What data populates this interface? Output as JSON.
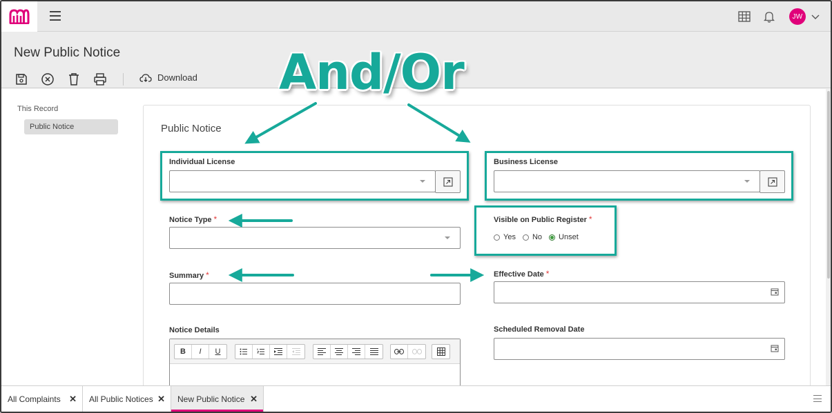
{
  "topbar": {
    "avatar_initials": "JW",
    "icons": [
      "app-logo-icon",
      "hamburger-menu-icon",
      "grid-icon",
      "bell-icon",
      "chevron-down-icon"
    ],
    "accent_color": "#e0007a"
  },
  "header": {
    "title": "New Public Notice",
    "download_label": "Download",
    "toolbar_icons": [
      "save-icon",
      "cancel-icon",
      "delete-icon",
      "print-icon",
      "cloud-download-icon"
    ]
  },
  "leftnav": {
    "section_label": "This Record",
    "items": [
      {
        "label": "Public Notice",
        "selected": true
      }
    ]
  },
  "form": {
    "title": "Public Notice",
    "individual_license": {
      "label": "Individual License",
      "value": ""
    },
    "business_license": {
      "label": "Business License",
      "value": ""
    },
    "notice_type": {
      "label": "Notice Type",
      "required_mark": "*",
      "value": ""
    },
    "visible_on_register": {
      "label": "Visible on Public Register",
      "required_mark": "*",
      "options": [
        "Yes",
        "No",
        "Unset"
      ],
      "selected": "Unset"
    },
    "summary": {
      "label": "Summary",
      "required_mark": "*",
      "value": ""
    },
    "effective_date": {
      "label": "Effective Date",
      "required_mark": "*",
      "value": ""
    },
    "notice_details": {
      "label": "Notice Details",
      "value": ""
    },
    "scheduled_removal_date": {
      "label": "Scheduled Removal Date",
      "value": ""
    },
    "editor_buttons": {
      "bold": "B",
      "italic": "I",
      "underline": "U"
    }
  },
  "annotation": {
    "text": "And/Or",
    "color": "#17a99a"
  },
  "tabs": [
    {
      "label": "All Complaints",
      "close": "✕",
      "active": false
    },
    {
      "label": "All Public Notices",
      "close": "✕",
      "active": false
    },
    {
      "label": "New Public Notice",
      "close": "✕",
      "active": true
    }
  ]
}
